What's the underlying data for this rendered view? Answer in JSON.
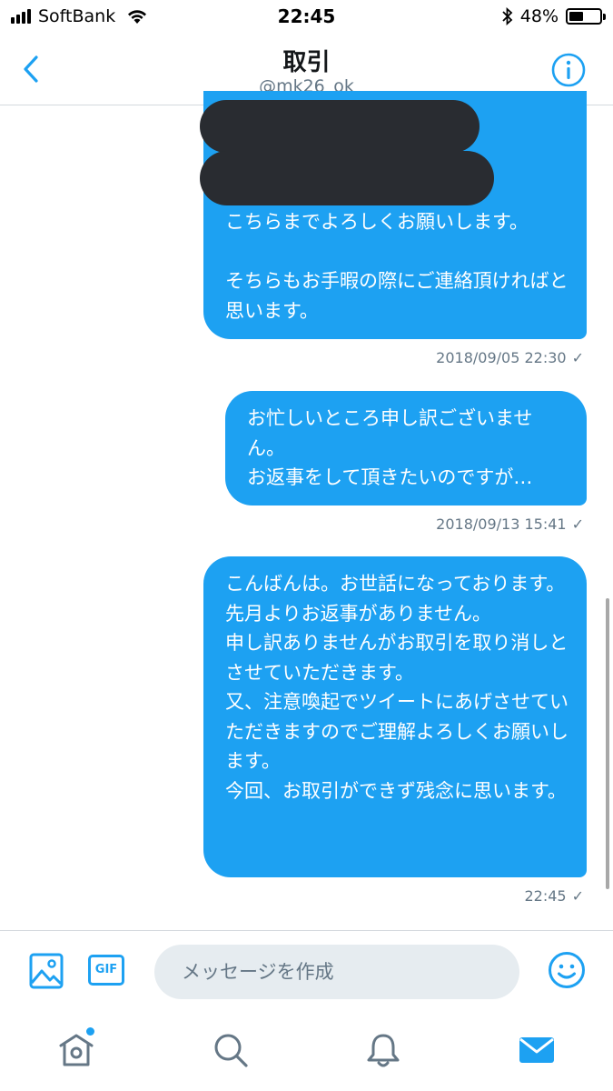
{
  "status_bar": {
    "carrier": "SoftBank",
    "time": "22:45",
    "battery_percent": "48%",
    "battery_level": 0.48,
    "icons": [
      "signal-icon",
      "wifi-icon",
      "bluetooth-icon",
      "battery-icon"
    ]
  },
  "header": {
    "title": "取引",
    "handle": "@mk26_ok",
    "back_icon": "chevron-left-icon",
    "info_icon": "info-icon"
  },
  "messages": [
    {
      "text": "こちらまでよろしくお願いします。\n\nそちらもお手暇の際にご連絡頂ければと思います。",
      "timestamp": "2018/09/05 22:30",
      "status": "✓",
      "redacted_lines": 2
    },
    {
      "text": "お忙しいところ申し訳ございません。\nお返事をして頂きたいのですが…",
      "timestamp": "2018/09/13 15:41",
      "status": "✓"
    },
    {
      "text": "こんばんは。お世話になっております。\n先月よりお返事がありません。\n申し訳ありませんがお取引を取り消しとさせていただきます。\n又、注意喚起でツイートにあげさせていただきますのでご理解よろしくお願いします。\n今回、お取引ができず残念に思います。",
      "timestamp": "22:45",
      "status": "✓"
    }
  ],
  "composer": {
    "placeholder": "メッセージを作成",
    "gif_label": "GIF",
    "icons": [
      "image-icon",
      "gif-icon",
      "emoji-icon"
    ]
  },
  "tab_bar": {
    "tabs": [
      "home-icon",
      "search-icon",
      "notifications-icon",
      "messages-icon"
    ],
    "active": "messages-icon"
  },
  "colors": {
    "accent": "#1da1f2",
    "bubble_text": "#ffffff",
    "timestamp": "#657786",
    "input_bg": "#e6ecf0"
  }
}
